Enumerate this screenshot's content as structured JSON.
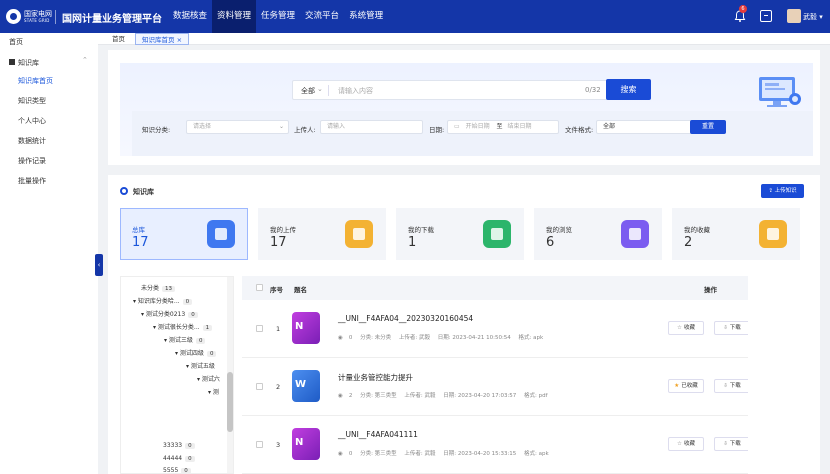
{
  "header": {
    "logo_text": "国家电网",
    "logo_subtext": "STATE GRID",
    "app_title": "国网计量业务管理平台",
    "nav": [
      "数据核查",
      "资料管理",
      "任务管理",
      "交流平台",
      "系统管理"
    ],
    "active_nav": "资料管理",
    "notification_count": "6",
    "user_name": "武毅"
  },
  "sidebar": {
    "home": "首页",
    "group": "知识库",
    "items": [
      "知识库首页",
      "知识类型",
      "个人中心",
      "数据统计",
      "操作记录",
      "批量操作"
    ],
    "active_item": "知识库首页"
  },
  "tabs": [
    "首页",
    "知识库首页"
  ],
  "search": {
    "scope": "全部",
    "placeholder": "请输入内容",
    "counter": "0/32",
    "button": "搜索"
  },
  "filters": {
    "category_label": "知识分类:",
    "category_placeholder": "请选择",
    "uploader_label": "上传人:",
    "uploader_placeholder": "请输入",
    "date_label": "日期:",
    "start_placeholder": "开始日期",
    "date_sep": "至",
    "end_placeholder": "结束日期",
    "format_label": "文件格式:",
    "format_value": "全部",
    "reset_button": "重置"
  },
  "kb": {
    "title": "知识库",
    "upload_button": "上传知识",
    "stats": [
      {
        "label": "总库",
        "value": "17",
        "color": "#3f78f0"
      },
      {
        "label": "我的上传",
        "value": "17",
        "color": "#f3b233"
      },
      {
        "label": "我的下载",
        "value": "1",
        "color": "#2cb56b"
      },
      {
        "label": "我的浏览",
        "value": "6",
        "color": "#7b5cf0"
      },
      {
        "label": "我的收藏",
        "value": "2",
        "color": "#f3b233"
      }
    ]
  },
  "tree": [
    {
      "label": "未分类",
      "count": "13"
    },
    {
      "label": "知识库分类哈...",
      "count": "0"
    },
    {
      "label": "测试分类0213",
      "count": "0"
    },
    {
      "label": "测试很长分类...",
      "count": "1"
    },
    {
      "label": "测试三级",
      "count": "0"
    },
    {
      "label": "测试四级",
      "count": "0"
    },
    {
      "label": "测试五级",
      "count": ""
    },
    {
      "label": "测试六",
      "count": ""
    },
    {
      "label": "测",
      "count": ""
    },
    {
      "label": "33333",
      "count": "0"
    },
    {
      "label": "44444",
      "count": "0"
    },
    {
      "label": "5555",
      "count": "0"
    }
  ],
  "table": {
    "headers": {
      "index": "序号",
      "title": "题名",
      "actions": "操作"
    },
    "rows": [
      {
        "index": "1",
        "icon": "onenote-icon",
        "title": "__UNI__F4AFA04__20230320160454",
        "views": "0",
        "category": "分类: 未分类",
        "uploader": "上传者: 武毅",
        "date": "日期: 2023-04-21 10:50:54",
        "format": "格式: apk",
        "fav_label": "收藏",
        "fav_on": false,
        "download_label": "下载"
      },
      {
        "index": "2",
        "icon": "word-icon",
        "title": "计量业务管控能力提升",
        "views": "2",
        "category": "分类: 第三类型",
        "uploader": "上传者: 武毅",
        "date": "日期: 2023-04-20 17:03:57",
        "format": "格式: pdf",
        "fav_label": "已收藏",
        "fav_on": true,
        "download_label": "下载"
      },
      {
        "index": "3",
        "icon": "onenote-icon",
        "title": "__UNI__F4AFA041111",
        "views": "0",
        "category": "分类: 第三类型",
        "uploader": "上传者: 武毅",
        "date": "日期: 2023-04-20 15:33:15",
        "format": "格式: apk",
        "fav_label": "收藏",
        "fav_on": false,
        "download_label": "下载"
      }
    ]
  }
}
